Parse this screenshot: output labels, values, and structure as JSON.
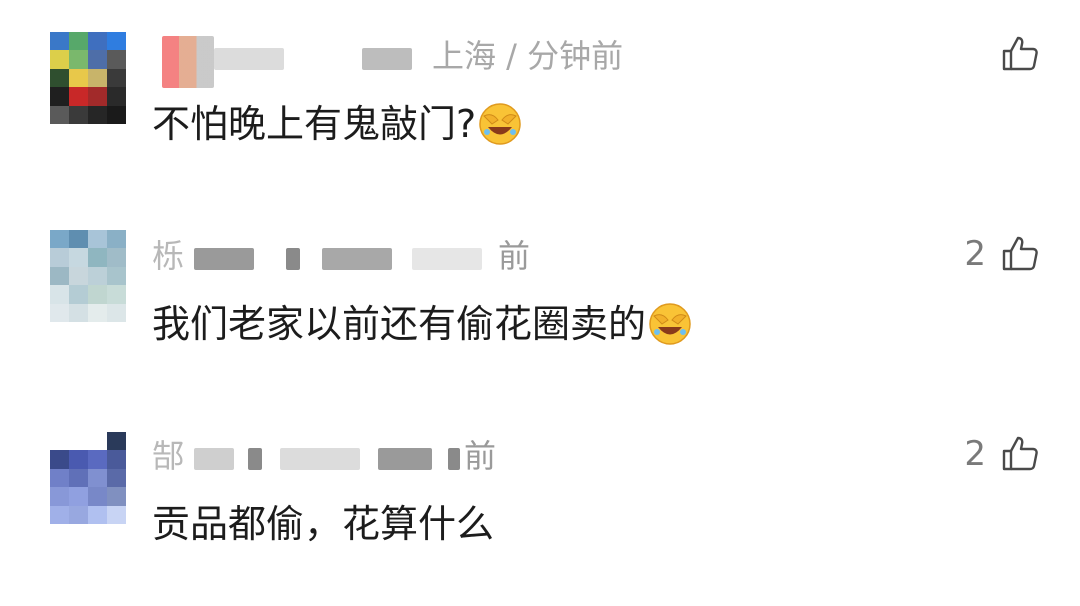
{
  "comments": [
    {
      "avatar_colors": [
        "#3a78c8",
        "#57a86a",
        "#3f6fbf",
        "#2f7de0",
        "#dccf4a",
        "#7ab86c",
        "#4e6ea8",
        "#5a5a5a",
        "#2f4f2f",
        "#e8c84a",
        "#c8b46a",
        "#3a3a3a",
        "#1f1f1f",
        "#c82828",
        "#a22a2a",
        "#2a2a2a",
        "#5a5a5a",
        "#3a3a3a",
        "#262626",
        "#1a1a1a"
      ],
      "username": "",
      "location_time": "上海 / 分钟前",
      "text": "不怕晚上有鬼敲门?",
      "has_emoji": true,
      "likes": ""
    },
    {
      "avatar_colors": [
        "#7aa8c8",
        "#5f8eb0",
        "#a8c4d8",
        "#8ab0c6",
        "#b8ccd8",
        "#c6d8e0",
        "#8fb6c0",
        "#a0bcc8",
        "#9cb8c4",
        "#c8d6dc",
        "#bcd0d8",
        "#a8c4cc",
        "#d8e4e8",
        "#b4ccd4",
        "#c0d6d0",
        "#c8dcd8",
        "#e0e8ec",
        "#d4e0e4",
        "#e4ecec",
        "#dce6e8"
      ],
      "username": "",
      "location_time": "前",
      "text": "我们老家以前还有偷花圈卖的",
      "has_emoji": true,
      "likes": "2"
    },
    {
      "avatar_colors": [
        "#ffffff",
        "#ffffff",
        "#ffffff",
        "#2a3a5a",
        "#3a4a8a",
        "#4a5ab0",
        "#5a6ac0",
        "#4a5a9a",
        "#7080c8",
        "#6070b8",
        "#8090d0",
        "#5a6aa8",
        "#8898d8",
        "#90a0e0",
        "#7888c8",
        "#8090c0",
        "#a0b0e8",
        "#98a8e0",
        "#b0c0f0",
        "#c8d4f4"
      ],
      "username": "",
      "location_time": "前",
      "text": "贡品都偷，花算什么",
      "has_emoji": false,
      "likes": "2"
    }
  ]
}
